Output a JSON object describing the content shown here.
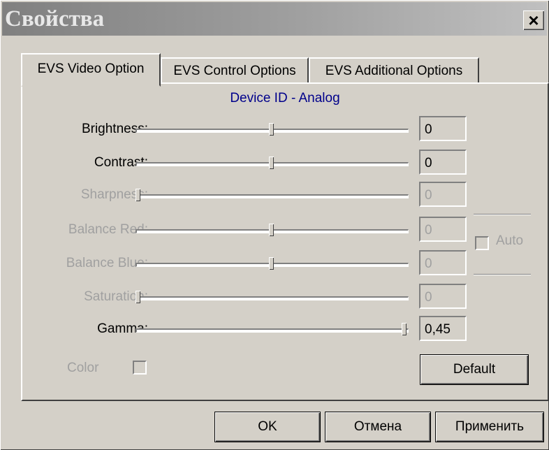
{
  "window": {
    "title": "Свойства",
    "close_label": "×"
  },
  "tabs": [
    {
      "label": "EVS Video Option",
      "active": true
    },
    {
      "label": "EVS Control Options",
      "active": false
    },
    {
      "label": "EVS Additional Options",
      "active": false
    }
  ],
  "panel": {
    "device_id": "Device ID - Analog",
    "sliders": [
      {
        "label": "Brightness:",
        "value": "0",
        "position": 0.5,
        "enabled": true
      },
      {
        "label": "Contrast:",
        "value": "0",
        "position": 0.5,
        "enabled": true
      },
      {
        "label": "Sharpness:",
        "value": "0",
        "position": 0.0,
        "enabled": false
      },
      {
        "label": "Balance Red:",
        "value": "0",
        "position": 0.5,
        "enabled": false
      },
      {
        "label": "Balance Blue:",
        "value": "0",
        "position": 0.5,
        "enabled": false
      },
      {
        "label": "Saturation:",
        "value": "0",
        "position": 0.0,
        "enabled": false
      },
      {
        "label": "Gamma:",
        "value": "0,45",
        "position": 1.0,
        "enabled": true
      }
    ],
    "auto_label": "Auto",
    "auto_checked": false,
    "color_label": "Color",
    "color_checked": false,
    "default_label": "Default"
  },
  "footer": {
    "ok_label": "OK",
    "cancel_label": "Отмена",
    "apply_label": "Применить"
  }
}
